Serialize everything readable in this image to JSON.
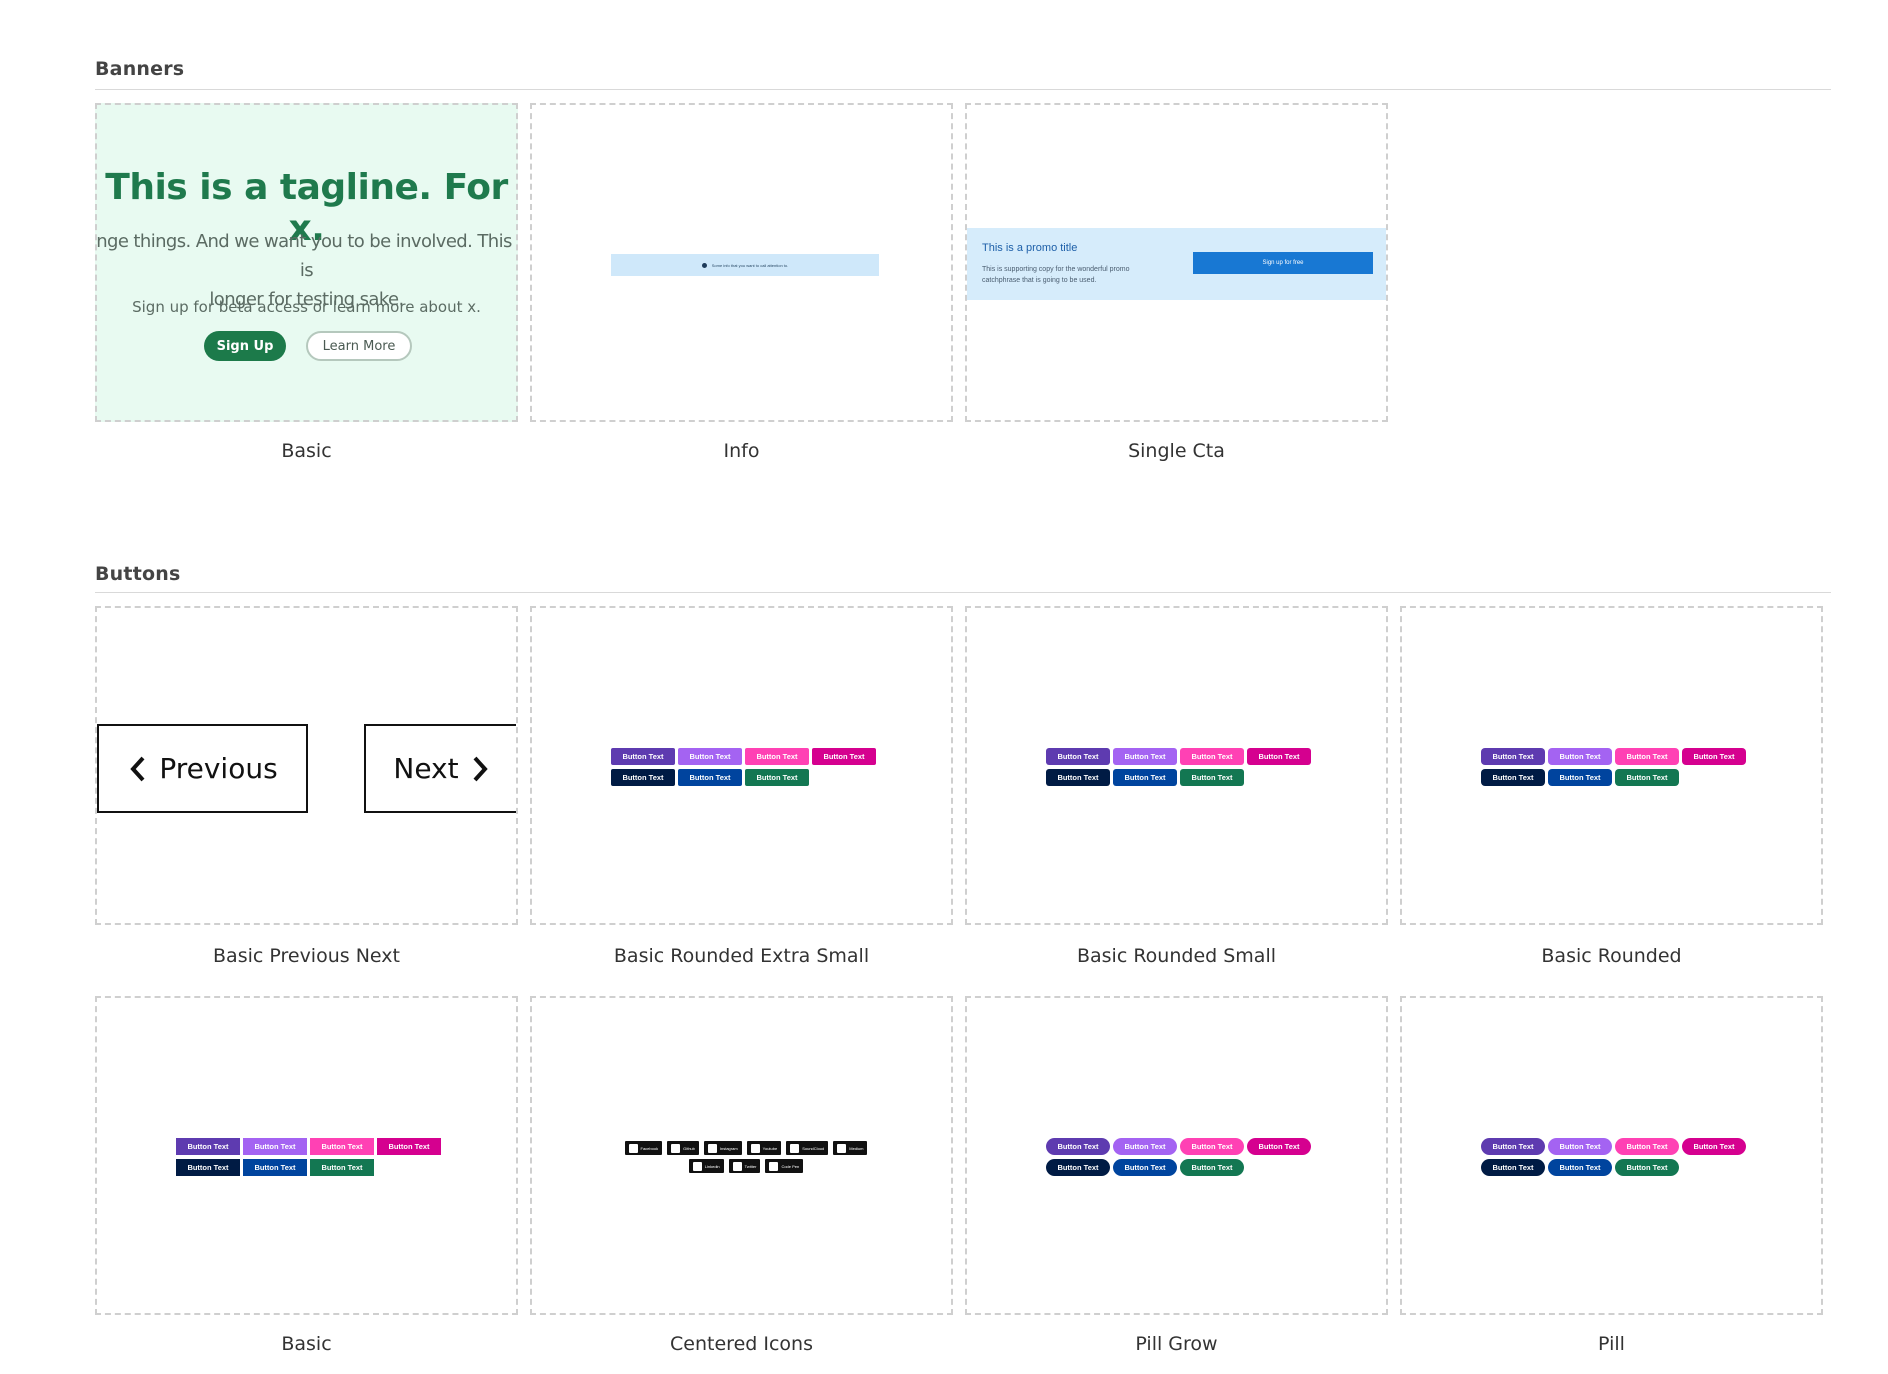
{
  "sections": {
    "banners": {
      "title": "Banners",
      "cards": [
        {
          "caption": "Basic"
        },
        {
          "caption": "Info"
        },
        {
          "caption": "Single Cta"
        }
      ],
      "basic": {
        "tagline": "This is a tagline. For x.",
        "body_line1": "Change things. And we want you to be involved. This text is",
        "body_line2": "longer for testing sake.",
        "subtext": "Sign up for beta access or learn more about x.",
        "signup_label": "Sign Up",
        "learn_label": "Learn More"
      },
      "info": {
        "text": "Some info that you want to call attention to."
      },
      "single_cta": {
        "title": "This is a promo title",
        "copy": "This is supporting copy for the wonderful promo catchphrase that is going to be used.",
        "button": "Sign up for free"
      }
    },
    "buttons": {
      "title": "Buttons",
      "cards": [
        {
          "caption": "Basic Previous Next"
        },
        {
          "caption": "Basic Rounded Extra Small"
        },
        {
          "caption": "Basic Rounded Small"
        },
        {
          "caption": "Basic Rounded"
        },
        {
          "caption": "Basic"
        },
        {
          "caption": "Centered Icons"
        },
        {
          "caption": "Pill Grow"
        },
        {
          "caption": "Pill"
        }
      ],
      "prev_label": "Previous",
      "next_label": "Next",
      "button_text": "Button Text",
      "icons": [
        "Facebook",
        "Github",
        "Instagram",
        "Youtube",
        "SoundCloud",
        "Medium",
        "Linkedin",
        "Twitter",
        "Code Pen"
      ]
    }
  },
  "colors": {
    "purple": "#5e3bb0",
    "light_purple": "#a463f2",
    "pink": "#ff41b4",
    "magenta": "#d5008f",
    "navy": "#001b44",
    "blue": "#00449e",
    "green": "#137752",
    "banner_green": "#1c7a4a"
  }
}
